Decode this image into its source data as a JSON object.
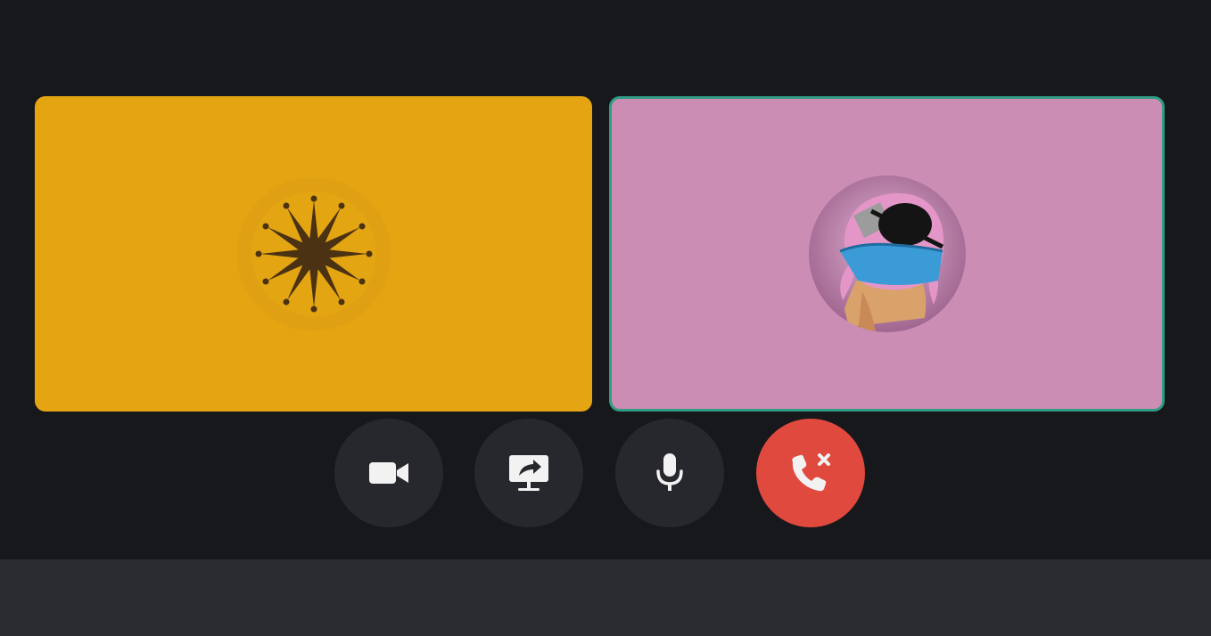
{
  "colors": {
    "stage_background": "#17181c",
    "bottom_bar": "#2b2c31",
    "tile_left": "#e5a512",
    "tile_right": "#cb8db3",
    "speaking_border": "#2f9c83",
    "control_button": "#27282d",
    "leave_button": "#e0493e",
    "icon": "#f2f2f2"
  },
  "participants": [
    {
      "avatar": "star-burst-avatar",
      "tile_color": "#e5a512",
      "speaking": false
    },
    {
      "avatar": "pink-character-avatar",
      "tile_color": "#cb8db3",
      "speaking": true
    }
  ],
  "controls": [
    {
      "icon": "video-camera-icon"
    },
    {
      "icon": "screen-share-icon"
    },
    {
      "icon": "microphone-icon"
    },
    {
      "icon": "hang-up-icon"
    }
  ]
}
